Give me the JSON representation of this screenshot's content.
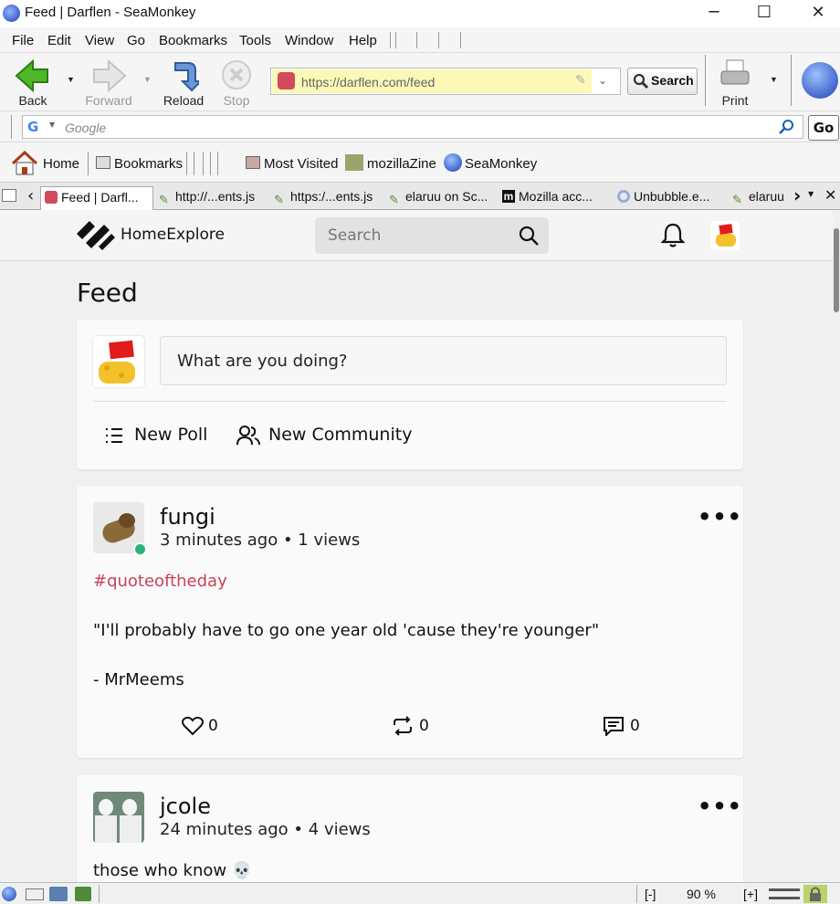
{
  "window": {
    "title": "Feed | Darflen - SeaMonkey",
    "minimize": "─",
    "maximize": "☐",
    "close": "✕"
  },
  "menu": [
    "File",
    "Edit",
    "View",
    "Go",
    "Bookmarks",
    "Tools",
    "Window",
    "Help"
  ],
  "nav": {
    "back": "Back",
    "forward": "Forward",
    "reload": "Reload",
    "stop": "Stop",
    "url": "https://darflen.com/feed",
    "search_button": "Search",
    "print": "Print"
  },
  "google_bar": {
    "placeholder": "Google",
    "go": "Go"
  },
  "bookmarks": {
    "home": "Home",
    "bookmarks": "Bookmarks",
    "most_visited": "Most Visited",
    "mozillazine": "mozillaZine",
    "seamonkey": "SeaMonkey"
  },
  "tabs": [
    {
      "label": "Feed | Darfl..."
    },
    {
      "label": "http://...ents.js"
    },
    {
      "label": "https:/...ents.js"
    },
    {
      "label": "elaruu on Sc..."
    },
    {
      "label": "Mozilla acc..."
    },
    {
      "label": "Unbubble.e..."
    },
    {
      "label": "elaruu"
    }
  ],
  "site": {
    "brand": "HomeExplore",
    "search_placeholder": "Search",
    "feed_title": "Feed",
    "composer_placeholder": "What are you doing?",
    "new_poll": "New Poll",
    "new_community": "New Community"
  },
  "posts": [
    {
      "username": "fungi",
      "meta": "3 minutes ago • 1 views",
      "hashtag": "#quoteoftheday",
      "quote": "\"I'll probably have to go one year old 'cause they're younger\"",
      "author": "- MrMeems",
      "likes": "0",
      "reposts": "0",
      "comments": "0"
    },
    {
      "username": "jcole",
      "meta": "24 minutes ago • 4 views",
      "text": "those who know 💀"
    }
  ],
  "status": {
    "zoom_out": "[-]",
    "zoom": "90 %",
    "zoom_in": "[+]"
  }
}
